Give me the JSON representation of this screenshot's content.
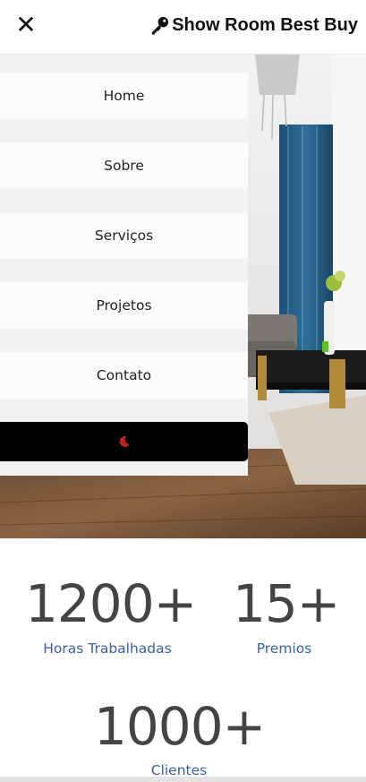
{
  "header": {
    "close_glyph": "✕",
    "brand_name": "Show Room Best Buy",
    "brand_icon": "key-icon"
  },
  "menu": {
    "items": [
      {
        "label": "Home"
      },
      {
        "label": "Sobre"
      },
      {
        "label": "Serviços"
      },
      {
        "label": "Projetos"
      },
      {
        "label": "Contato"
      }
    ],
    "theme_toggle_icon": "moon-icon",
    "theme_icon_color": "#c0202a"
  },
  "stats": [
    {
      "value": "1200+",
      "label": "Horas Trabalhadas"
    },
    {
      "value": "15+",
      "label": "Premios"
    },
    {
      "value": "1000+",
      "label": "Clientes"
    }
  ],
  "colors": {
    "accent_label": "#3b5fa8",
    "menu_button_bg": "#000000"
  }
}
